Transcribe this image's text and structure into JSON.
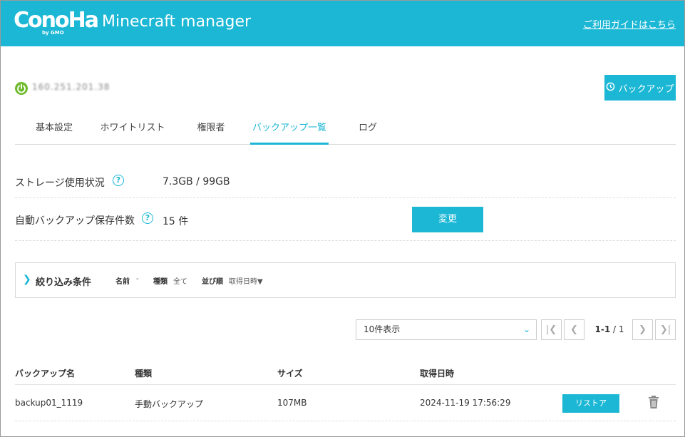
{
  "header": {
    "logo_text": "ConoHa",
    "logo_sub": "by GMO",
    "app_title": "Minecraft manager",
    "guide_link": "ご利用ガイドはこちら",
    "bg_color": "#1bb7d5"
  },
  "server": {
    "status_icon": "power-icon",
    "address": "160.251.201.38"
  },
  "actions": {
    "backup_label": "バックアップ"
  },
  "tabs": [
    {
      "label": "基本設定"
    },
    {
      "label": "ホワイトリスト"
    },
    {
      "label": "権限者"
    },
    {
      "label": "バックアップ一覧",
      "active": true
    },
    {
      "label": "ログ"
    }
  ],
  "storage": {
    "label": "ストレージ使用状況",
    "value": "7.3GB / 99GB"
  },
  "auto_backup": {
    "label": "自動バックアップ保存件数",
    "value": "15 件",
    "change_label": "変更"
  },
  "filter": {
    "title": "絞り込み条件",
    "name_label": "名前",
    "name_value": "-",
    "type_label": "種類",
    "type_value": "全て",
    "sort_label": "並び順",
    "sort_value": "取得日時▼"
  },
  "pagination": {
    "per_page": "10件表示",
    "range": "1-1",
    "total": "/ 1"
  },
  "table": {
    "headers": [
      "バックアップ名",
      "種類",
      "サイズ",
      "取得日時"
    ],
    "rows": [
      {
        "name": "backup01_1119",
        "type": "手動バックアップ",
        "size": "107MB",
        "date": "2024-11-19 17:56:29",
        "restore_label": "リストア"
      }
    ]
  }
}
